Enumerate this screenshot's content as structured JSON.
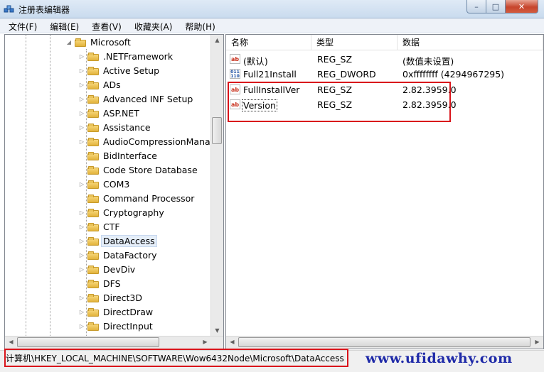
{
  "window": {
    "title": "注册表编辑器",
    "buttons": {
      "minimize": "–",
      "maximize": "□",
      "close": "✕"
    }
  },
  "menu": [
    "文件(F)",
    "编辑(E)",
    "查看(V)",
    "收藏夹(A)",
    "帮助(H)"
  ],
  "tree": {
    "parent": "Microsoft",
    "children": [
      ".NETFramework",
      "Active Setup",
      "ADs",
      "Advanced INF Setup",
      "ASP.NET",
      "Assistance",
      "AudioCompressionManag",
      "BidInterface",
      "Code Store Database",
      "COM3",
      "Command Processor",
      "Cryptography",
      "CTF",
      "DataAccess",
      "DataFactory",
      "DevDiv",
      "DFS",
      "Direct3D",
      "DirectDraw",
      "DirectInput"
    ],
    "selected": "DataAccess"
  },
  "list": {
    "headers": {
      "name": "名称",
      "type": "类型",
      "data": "数据"
    },
    "rows": [
      {
        "name": "(默认)",
        "type": "REG_SZ",
        "data": "(数值未设置)",
        "icon": "string-value-icon"
      },
      {
        "name": "Full21Install",
        "type": "REG_DWORD",
        "data": "0xffffffff (4294967295)",
        "icon": "binary-value-icon"
      },
      {
        "name": "FullInstallVer",
        "type": "REG_SZ",
        "data": "2.82.3959.0",
        "icon": "string-value-icon"
      },
      {
        "name": "Version",
        "type": "REG_SZ",
        "data": "2.82.3959.0",
        "icon": "string-value-icon"
      }
    ]
  },
  "status": {
    "path": "计算机\\HKEY_LOCAL_MACHINE\\SOFTWARE\\Wow6432Node\\Microsoft\\DataAccess"
  },
  "watermark": "www.ufidawhy.com",
  "colors": {
    "highlight": "#d9141b",
    "watermark": "#1f2aa8"
  }
}
